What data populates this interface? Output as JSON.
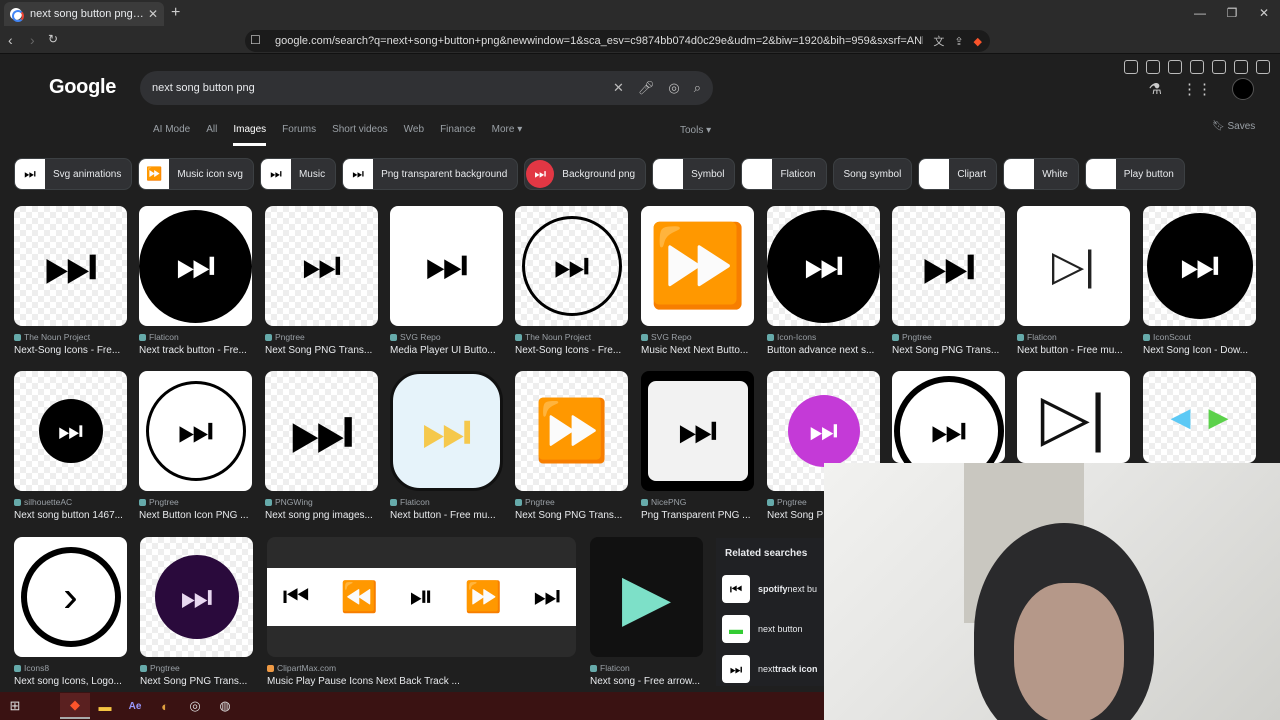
{
  "browser": {
    "tab_title": "next song button png - Google",
    "url": "google.com/search?q=next+song+button+png&newwindow=1&sca_esv=c9874bb074d0c29e&udm=2&biw=1920&bih=959&sxsrf=ANbL-n74s7Dr..."
  },
  "search": {
    "query": "next song button png"
  },
  "logo": "Google",
  "filters": [
    "AI Mode",
    "All",
    "Images",
    "Forums",
    "Short videos",
    "Web",
    "Finance",
    "More"
  ],
  "filter_active": "Images",
  "tools_label": "Tools",
  "saves_label": "Saves",
  "chips": [
    {
      "label": "Svg animations",
      "thumb": "⏭"
    },
    {
      "label": "Music icon svg",
      "thumb": "⏩"
    },
    {
      "label": "Music",
      "thumb": "⏭"
    },
    {
      "label": "Png transparent background",
      "thumb": "⏭"
    },
    {
      "label": "Background png",
      "thumb": "⏭",
      "red": true
    },
    {
      "label": "Symbol",
      "thumb": ""
    },
    {
      "label": "Flaticon",
      "thumb": ""
    },
    {
      "label": "Song symbol",
      "thumb": null
    },
    {
      "label": "Clipart",
      "thumb": ""
    },
    {
      "label": "White",
      "thumb": ""
    },
    {
      "label": "Play button",
      "thumb": ""
    }
  ],
  "results_row1": [
    {
      "source": "The Noun Project",
      "title": "Next-Song Icons - Fre..."
    },
    {
      "source": "Flaticon",
      "title": "Next track button - Fre..."
    },
    {
      "source": "Pngtree",
      "title": "Next Song PNG Trans..."
    },
    {
      "source": "SVG Repo",
      "title": "Media Player UI Butto..."
    },
    {
      "source": "The Noun Project",
      "title": "Next-Song Icons - Fre..."
    },
    {
      "source": "SVG Repo",
      "title": "Music Next Next Butto..."
    },
    {
      "source": "Icon-Icons",
      "title": "Button advance next s..."
    },
    {
      "source": "Pngtree",
      "title": "Next Song PNG Trans..."
    },
    {
      "source": "Flaticon",
      "title": "Next button - Free mu..."
    },
    {
      "source": "IconScout",
      "title": "Next Song Icon - Dow..."
    }
  ],
  "results_row2": [
    {
      "source": "silhouetteAC",
      "title": "Next song button 1467..."
    },
    {
      "source": "Pngtree",
      "title": "Next Button Icon PNG ..."
    },
    {
      "source": "PNGWing",
      "title": "Next song png images..."
    },
    {
      "source": "Flaticon",
      "title": "Next button - Free mu..."
    },
    {
      "source": "Pngtree",
      "title": "Next Song PNG Trans..."
    },
    {
      "source": "NicePNG",
      "title": "Png Transparent PNG ..."
    },
    {
      "source": "Pngtree",
      "title": "Next Song P"
    }
  ],
  "results_row3": [
    {
      "source": "Icons8",
      "title": "Next song Icons, Logo..."
    },
    {
      "source": "Pngtree",
      "title": "Next Song PNG Trans..."
    },
    {
      "source": "ClipartMax.com",
      "title": "Music Play Pause Icons Next Back Track ..."
    },
    {
      "source": "Flaticon",
      "title": "Next song - Free arrow..."
    }
  ],
  "related": {
    "heading": "Related searches",
    "items": [
      {
        "bold": "spotify",
        "rest": " next bu"
      },
      {
        "bold": "",
        "rest": "next button"
      },
      {
        "bold": "track icon",
        "pre": "next "
      }
    ]
  }
}
